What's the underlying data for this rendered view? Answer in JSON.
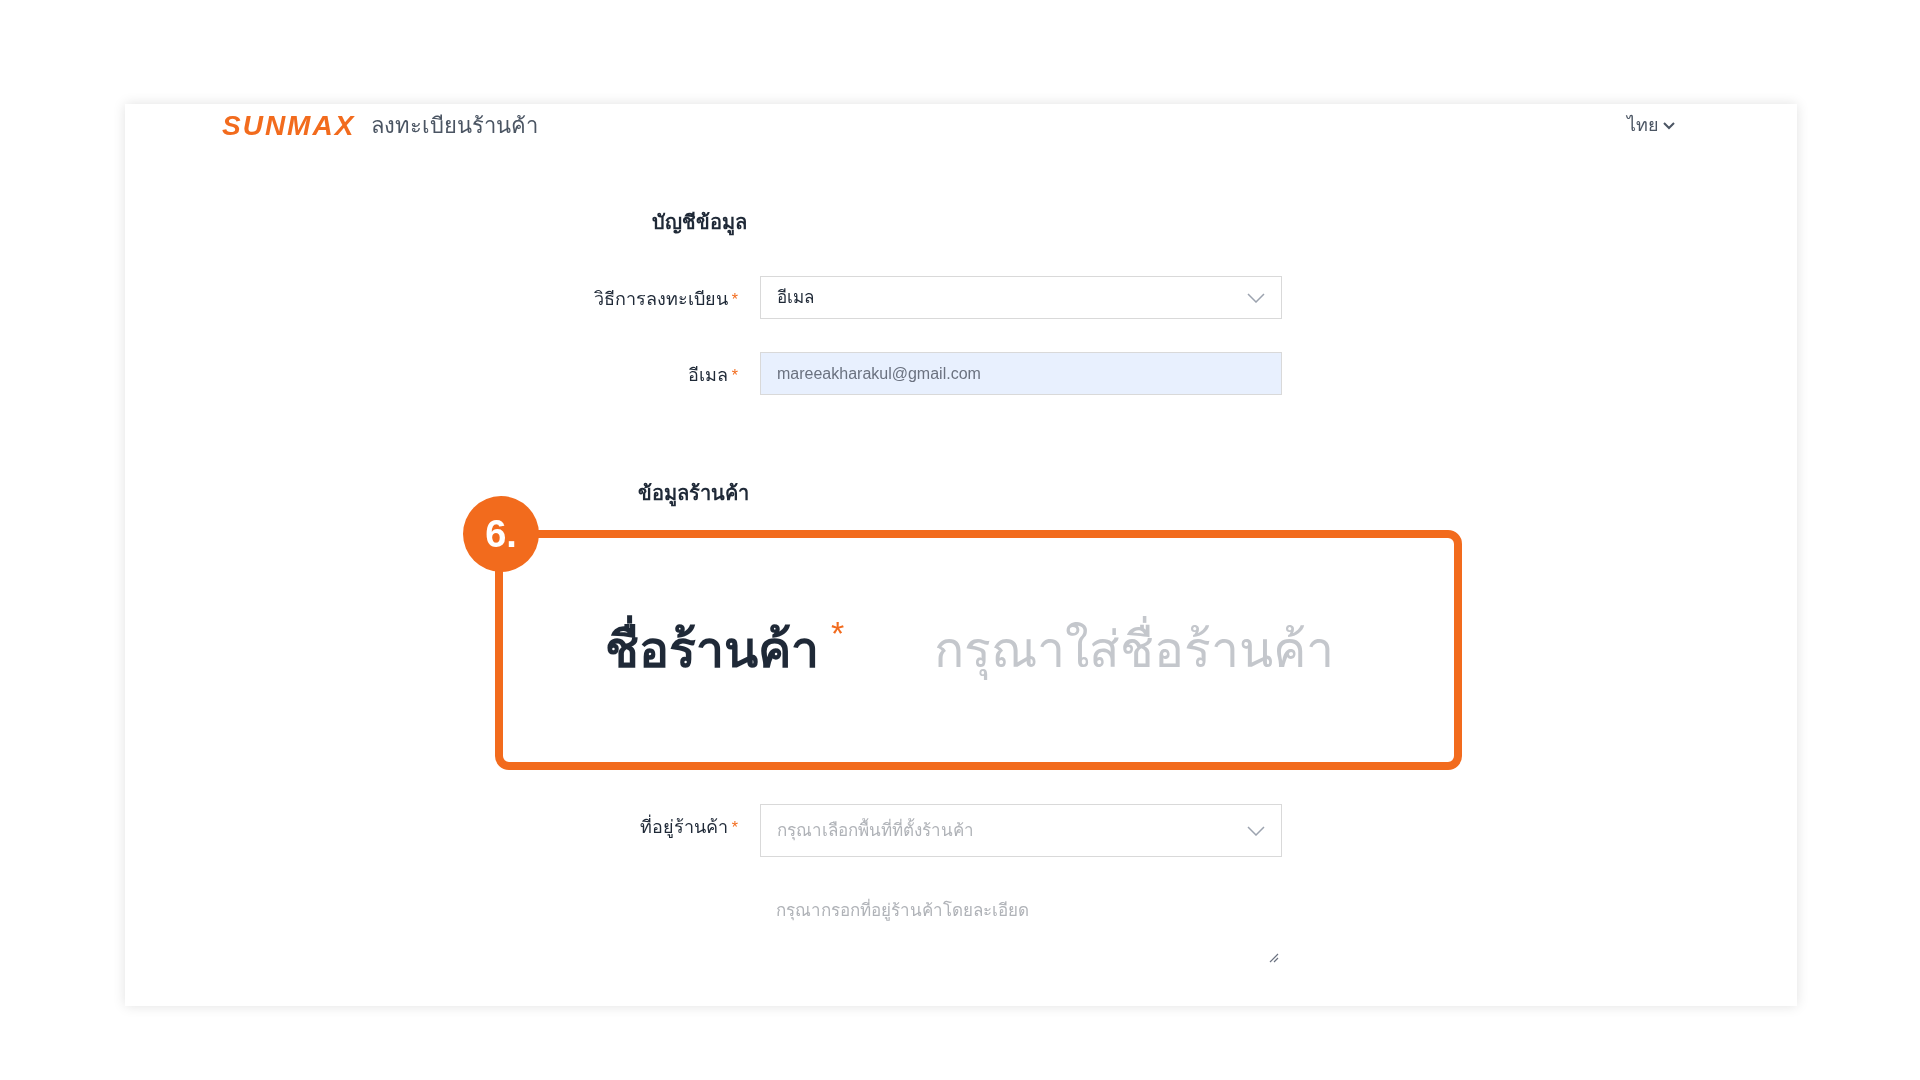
{
  "header": {
    "logo": "SUNMAX",
    "title": "ลงทะเบียนร้านค้า",
    "language": "ไทย"
  },
  "sections": [
    {
      "title": "บัญชีข้อมูล",
      "fields": [
        {
          "kind": "select",
          "label": "วิธีการลงทะเบียน",
          "required_mark": "*",
          "value": "อีเมล"
        },
        {
          "kind": "input",
          "label": "อีเมล",
          "required_mark": "*",
          "value": "mareeakharakul@gmail.com",
          "autofilled": true
        }
      ]
    },
    {
      "title": "ข้อมูลร้านค้า",
      "fields": [
        {
          "kind": "callout",
          "step": "6.",
          "label": "ชื่อร้านค้า",
          "required_mark": "*",
          "placeholder": "กรุณาใส่ชื่อร้านค้า"
        },
        {
          "kind": "select",
          "label": "ที่อยู่ร้านค้า",
          "required_mark": "*",
          "placeholder": "กรุณาเลือกพื้นที่ที่ตั้งร้านค้า"
        },
        {
          "kind": "textarea",
          "placeholder": "กรุณากรอกที่อยู่ร้านค้าโดยละเอียด"
        }
      ]
    }
  ]
}
